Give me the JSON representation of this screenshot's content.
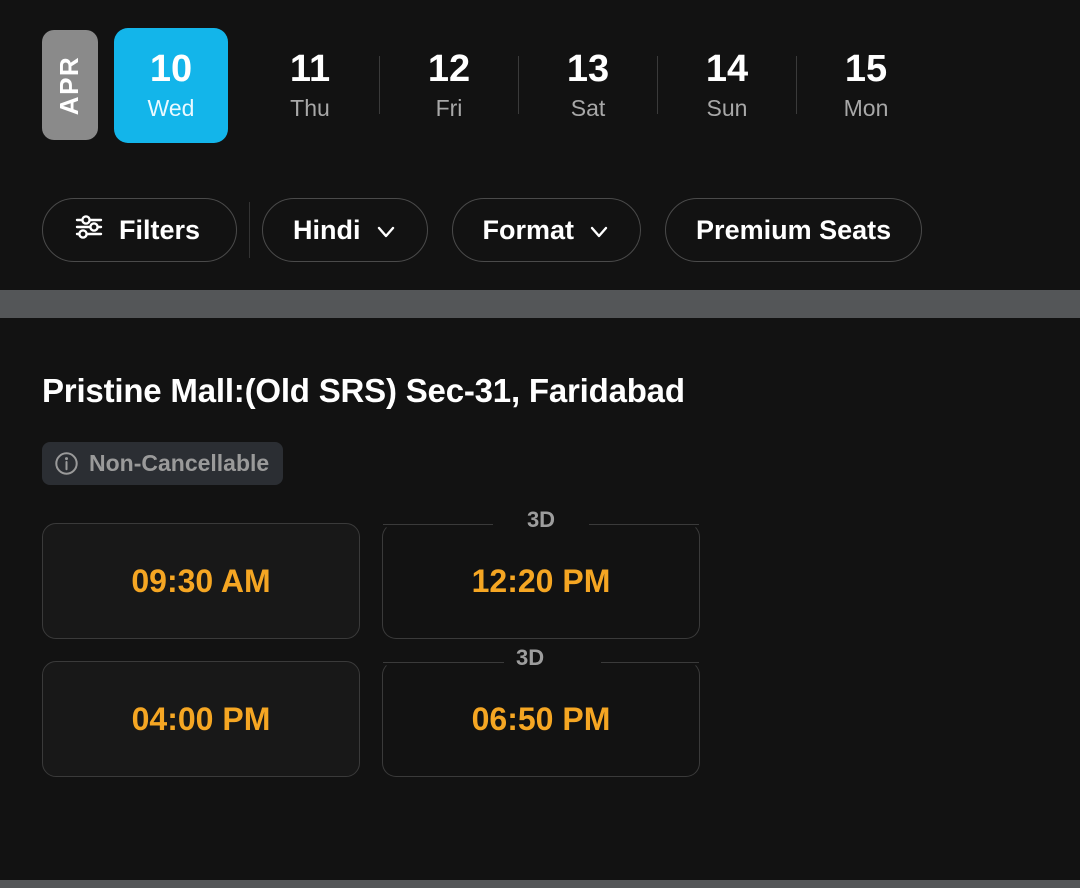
{
  "date_strip": {
    "month_label": "APR",
    "dates": [
      {
        "day_num": "10",
        "day_name": "Wed",
        "active": true
      },
      {
        "day_num": "11",
        "day_name": "Thu",
        "active": false
      },
      {
        "day_num": "12",
        "day_name": "Fri",
        "active": false
      },
      {
        "day_num": "13",
        "day_name": "Sat",
        "active": false
      },
      {
        "day_num": "14",
        "day_name": "Sun",
        "active": false
      },
      {
        "day_num": "15",
        "day_name": "Mon",
        "active": false
      }
    ]
  },
  "filters": {
    "filters_label": "Filters",
    "filters_icon": "sliders-icon",
    "language_label": "Hindi",
    "format_label": "Format",
    "premium_label": "Premium Seats"
  },
  "venue": {
    "name": "Pristine Mall:(Old SRS) Sec-31, Faridabad",
    "badge_label": "Non-Cancellable",
    "badge_icon": "info-icon"
  },
  "showtimes": [
    {
      "time": "09:30 AM",
      "tag": ""
    },
    {
      "time": "12:20 PM",
      "tag": "3D"
    },
    {
      "time": "04:00 PM",
      "tag": ""
    },
    {
      "time": "06:50 PM",
      "tag": "3D"
    }
  ],
  "colors": {
    "background": "#121212",
    "accent_blue": "#13b5ea",
    "accent_orange": "#f5a623",
    "band_gray": "#545658",
    "muted_text": "#a8a8a8"
  }
}
